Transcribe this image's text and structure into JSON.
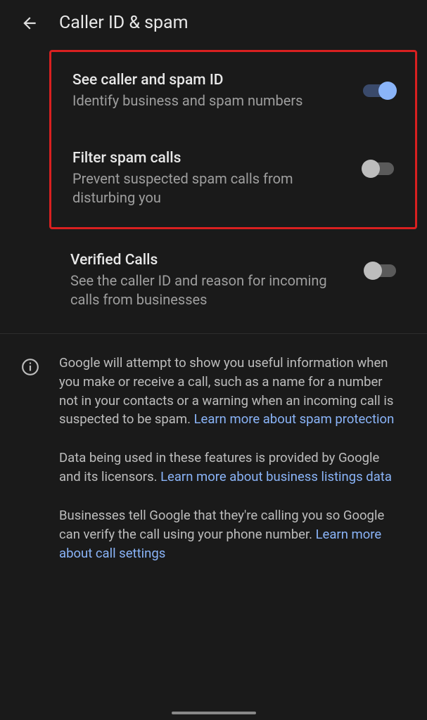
{
  "header": {
    "title": "Caller ID & spam"
  },
  "settings": {
    "see_caller": {
      "title": "See caller and spam ID",
      "desc": "Identify business and spam numbers",
      "on": true
    },
    "filter_spam": {
      "title": "Filter spam calls",
      "desc": "Prevent suspected spam calls from disturbing you",
      "on": false
    },
    "verified_calls": {
      "title": "Verified Calls",
      "desc": "See the caller ID and reason for incoming calls from businesses",
      "on": false
    }
  },
  "info": {
    "p1_text": "Google will attempt to show you useful information when you make or receive a call, such as a name for a number not in your contacts or a warning when an incoming call is suspected to be spam. ",
    "p1_link": "Learn more about spam protection",
    "p2_text": "Data being used in these features is provided by Google and its licensors. ",
    "p2_link": "Learn more about business listings data",
    "p3_text": "Businesses tell Google that they're calling you so Google can verify the call using your phone number. ",
    "p3_link": "Learn more about call settings"
  }
}
